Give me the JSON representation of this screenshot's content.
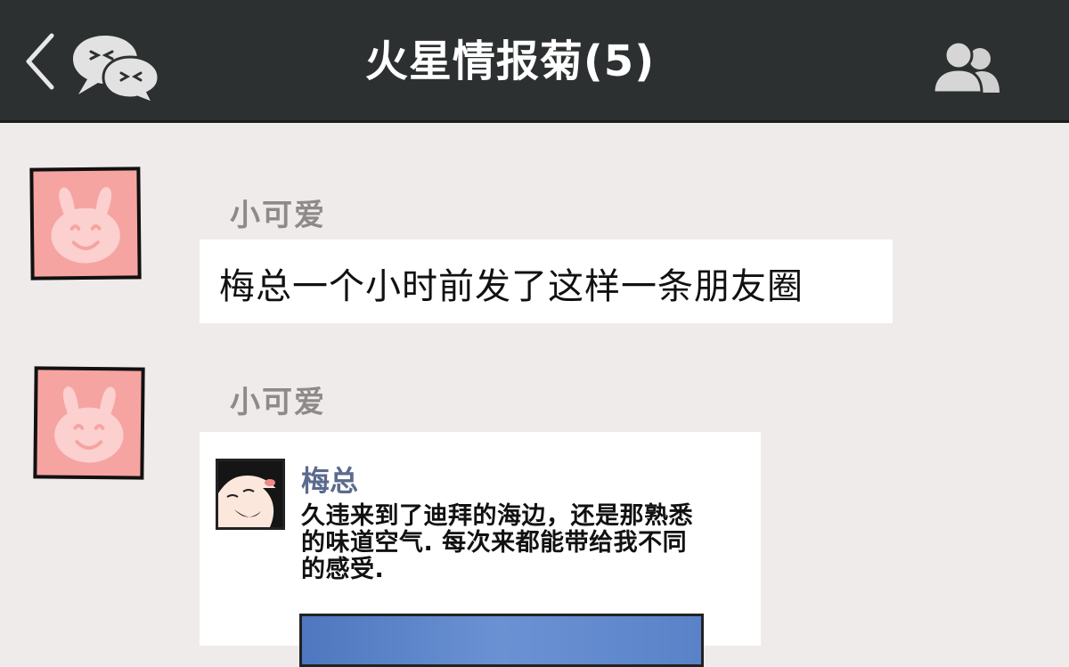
{
  "header": {
    "title": "火星情报菊(5)",
    "back_icon": "chevron-left-icon",
    "chat_icon": "wechat-chat-icon",
    "members_icon": "group-members-icon",
    "background": "#2c3030"
  },
  "messages": [
    {
      "sender": "小可爱",
      "avatar": "pink-bunny-avatar",
      "text": "梅总一个小时前发了这样一条朋友圈"
    },
    {
      "sender": "小可爱",
      "avatar": "pink-bunny-avatar",
      "shared_post": {
        "author": "梅总",
        "avatar": "cartoon-face-avatar",
        "text": "久违来到了迪拜的海边，还是那熟悉的味道空气. 每次来都能带给我不同的感受.",
        "has_photo": true
      }
    }
  ],
  "colors": {
    "chat_background": "#f0ebeb",
    "avatar_pink": "#f6a4a1",
    "sender_gray": "#8e8a8a",
    "author_blue": "#5b6a8e"
  }
}
